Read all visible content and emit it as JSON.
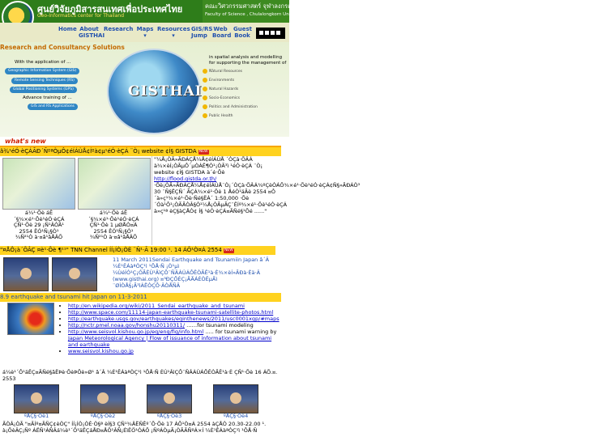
{
  "header": {
    "title_th": "ศูนย์วิจัยภูมิสารสนเทศเพื่อประเทศไทย",
    "title_en": "Geo-Informatics center for Thailand",
    "faculty_th": "คณะวิศวกรรมศาสตร์ จุฬาลงกรณ์มหาวิทยาลัย",
    "faculty_en": "Faculty of Science , Chulalongkorn University"
  },
  "nav": {
    "items": [
      {
        "label": "Home"
      },
      {
        "label": "About GISTHAI"
      },
      {
        "label": "Research"
      },
      {
        "label": "Maps ▾"
      },
      {
        "label": "Resources ▾"
      },
      {
        "label": "GIS/RS Jump"
      },
      {
        "label": "Web Board"
      },
      {
        "label": "Guest Book"
      }
    ]
  },
  "banner": {
    "heading": "Research and Consultancy Solutions",
    "with_app": "With the application of ...",
    "pills": [
      "Geographic Information System (GIS)",
      "Remote Sensing Techniques (RS)",
      "Global Positioning Systems (GPS)"
    ],
    "advance": "Advance training of ...",
    "training": "GIS and RS Applications",
    "logo_text": "GISTHAI",
    "in_spatial": "in spatial analysis and modelling for supporting the management of ...",
    "topics": [
      "Natural Resources",
      "Environments",
      "Natural Hazards",
      "Socio-Economics",
      "Politics and Administration",
      "Public Health"
    ]
  },
  "whats_new": "what's new",
  "news": {
    "flood_head": "ã¾¹éÓ·èÇÁÃÐ´ÑºªÒµÔ¢éÍÁÙÅ¢Íºà¢µ¹éÓ·èÇÁ ¨Ò¡ website ¢Í§ GISTDA",
    "flood_cap1": "á¼¹·Õè áÊ´§¾×é¹·Õè¹éÓ·èÇÁ ÇÑ¹·Õè 29 ¡Ñ¹ÂÒÂ¹ 2554 ÊÓ¹Ñ¡§Ò¹ ¾Ñ²¹Ò à·¤â¹âÅÂÕ",
    "flood_cap2": "á¼¹·Õè áÊ´§¾×é¹·Õè¹éÓ·èÇÁ ÇÑ¹·Õè 1 µØÅÒ¤Á 2554 ÊÓ¹Ñ¡§Ò¹ ¾Ñ²¹Ò à·¤â¹âÅÂÕ",
    "flood_text_pre": "\"¼Å¡ÒÃ»ÃÐÁÇÅ¼Å¢éÍÁÙÅ ´ÒÇà·ÕÂÁ à¾×èÍ¡ÒÃµÔ´µÒÁÊ¶Ò¹¡ÒÃ³ì ¹éÓ·èÇÁ ¨Ò¡ website ¢Í§ GISTDA à´é·Õè",
    "flood_link": "http://flood.gistda.or.th/",
    "flood_text_post": "·Õè¡ÒÃ»ÃÐÁÇÅ¼Å¢éÍÁÙÅ¨Ò¡´ÒÇà·ÕÂÁ¾ºÇèÒÁÕ¾×é¹·Õè¹éÓ·èÇÁ¢Ñ§»ÃÐÁÒ³ 30 ¨Ñ§ËÇÑ´ ÃÇÁ¾×é¹·Õè 1 ÅéÒ¹äÃè 2554 ¤Ô´à»ç¹¾×é¹·Õè·Ñé§ËÁ´ 1:50,000 ·Õè´Óà¹Ô¹¡ÒÃÃÒÂ§Ò¹¼Å¡ÒÃµÃÇ¨ÊÍº¾×é¹·Õè¹éÓ·èÇÁ à»ç¹ª èÇ§àÇÅÒ¢ Í§ ¹éÓ·èÇÁ¤ÃÑé§¹Õé ......\"",
    "tnn_head": "\"¤ÅÔ¡à´ÕÂÇ ¤è¹·Õè ¶¹¹\" TNN Channel ÍÍ¡ÍÒ¡ÒÈ ¨Ñ¹·Ã 19:00 ¹. 14 ÁÕ¹Ò¤Á 2554",
    "tnn_text": "11 March 2011Sendai Earthquake and Tsunamiin Japan â´Â ¼È¹ÊÁàªÒÇ¹ì ¹ÔÅ·Ñ ¡Ò¹µì ¼ÙéÍÓ¹Ç¡ÒÃÈÙ¹ÂìÇÔ¨ÑÂÀÙÁÔÊÒÃÊ¹à·È¾×èÍ»ÃÐà·Èä·Â (www.gisthai.org) ¤³ÐÇÔÈÇ¡ÃÃÁÈÒÊµÃì ¨ØÌÒÅ§¡Ã³ìÁËÒÇÔ·ÂÒÅÑÂ",
    "quake_head": "8.9 earthquake and tsunami hit Japan on 11-3-2011",
    "quake_links": [
      "http://en.wikipedia.org/wiki/2011_Sendai_earthquake_and_tsunami",
      "http://www.space.com/11114-japan-earthquake-tsunami-satellite-photos.html",
      "http://earthquake.usgs.gov/earthquakes/eqinthenews/2011/usc0001xgp/#maps",
      "http://nctr.pmel.noaa.gov/honshu20110311/",
      "http://www.seisvol.kishou.go.jp/eq/eng/fig/info.html",
      "Japan Meteorological Agency | Flow of issuance of information about tsunami and earthquake",
      "www.seisvol.kishou.go.jp"
    ],
    "quake_suffix_4": " ……for tsunami modeling",
    "quake_suffix_5": " ….. for tsunami warning by",
    "seminar_head": "á¼è¹´Ô¹äËÇ¤ÃÑé§ãËÞè·ÕèÞÕè»Ø¹ â´Â ¼È¹ÊÁàªÒÇ¹ì ¹ÔÅ·Ñ ÈÙ¹ÂìÇÔ¨ÑÂÀÙÁÔÊÒÃÊ¹à·È ÇÑ¹·Õè 16 ÁÕ.¤. 2553",
    "videos": [
      "ºÅÇ§·Õè1",
      "ºÅÇ§·Õè2",
      "ºÅÇ§·Õè3",
      "ºÅÇ§·Õè4"
    ],
    "seminar_text": "ÃÒÂ¡ÒÃ \"¤ÃÍº¤ÃÑÇ¢èÒÇ\" ÍÍ¡ÍÒ¡ÒÈ·Ò§ª èÍ§3 ÇÑ¹¾ÄËÑÊº´Õ·Õè 17 ÁÕ¹Ò¤Á 2554 àÇÅÒ 20.30-22.00 ¹. à¡ÕèÂÇ¡Ñº ÁËÑ¹ÀÑÂá¼è¹´Ô¹äËÇáÅÐ¤ÅÖ¹ÂÑ¡ÉìÊÖ¹ÒÁÔ ¡ÑºÁÒµÃ¡ÒÃÃÑºÁ×Í ¼È¹ÊÁàªÒÇ¹ì ¹ÔÅ·Ñ"
  },
  "colors": {
    "header_green": "#2e7d1a",
    "nav_bg": "#e9e9c7",
    "news_bar": "#ffd21f",
    "accent_red": "#d02000",
    "link": "#0000cc"
  }
}
